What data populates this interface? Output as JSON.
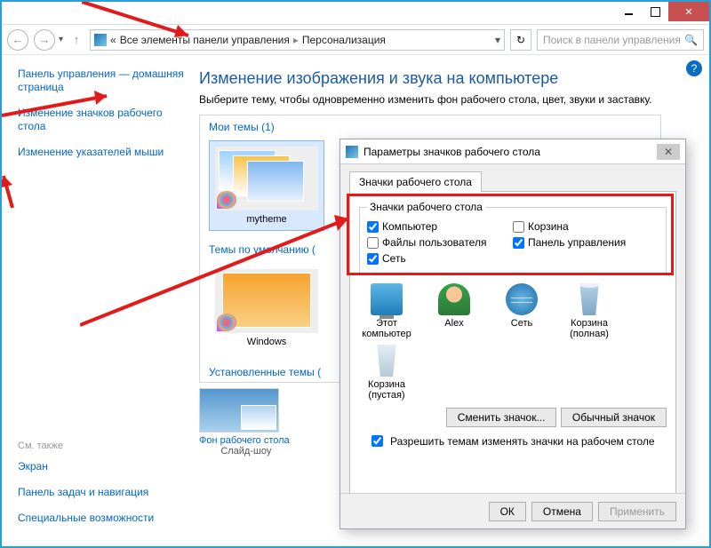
{
  "address": {
    "root": "Все элементы панели управления",
    "current": "Персонализация",
    "search_placeholder": "Поиск в панели управления"
  },
  "sidebar": {
    "home": "Панель управления — домашняя страница",
    "icons": "Изменение значков рабочего стола",
    "pointers": "Изменение указателей мыши",
    "see_also": "См. также",
    "screen": "Экран",
    "taskbar": "Панель задач и навигация",
    "accessibility": "Специальные возможности"
  },
  "content": {
    "title": "Изменение изображения и звука на компьютере",
    "subtitle": "Выберите тему, чтобы одновременно изменить фон рабочего стола, цвет, звуки и заставку.",
    "my_themes": "Мои темы (1)",
    "theme1": "mytheme",
    "default_themes": "Темы по умолчанию (",
    "theme2": "Windows",
    "installed_themes": "Установленные темы (",
    "bg_link": "Фон рабочего стола",
    "slideshow": "Слайд-шоу"
  },
  "dialog": {
    "title": "Параметры значков рабочего стола",
    "tab": "Значки рабочего стола",
    "legend": "Значки рабочего стола",
    "cb_computer": "Компьютер",
    "cb_bin": "Корзина",
    "cb_userfiles": "Файлы пользователя",
    "cb_cpanel": "Панель управления",
    "cb_network": "Сеть",
    "icon_pc": "Этот компьютер",
    "icon_user": "Alex",
    "icon_net": "Сеть",
    "icon_bin_full": "Корзина (полная)",
    "icon_bin_empty": "Корзина (пустая)",
    "btn_change": "Сменить значок...",
    "btn_default": "Обычный значок",
    "allow_themes": "Разрешить темам изменять значки на рабочем столе",
    "ok": "ОК",
    "cancel": "Отмена",
    "apply": "Применить"
  }
}
